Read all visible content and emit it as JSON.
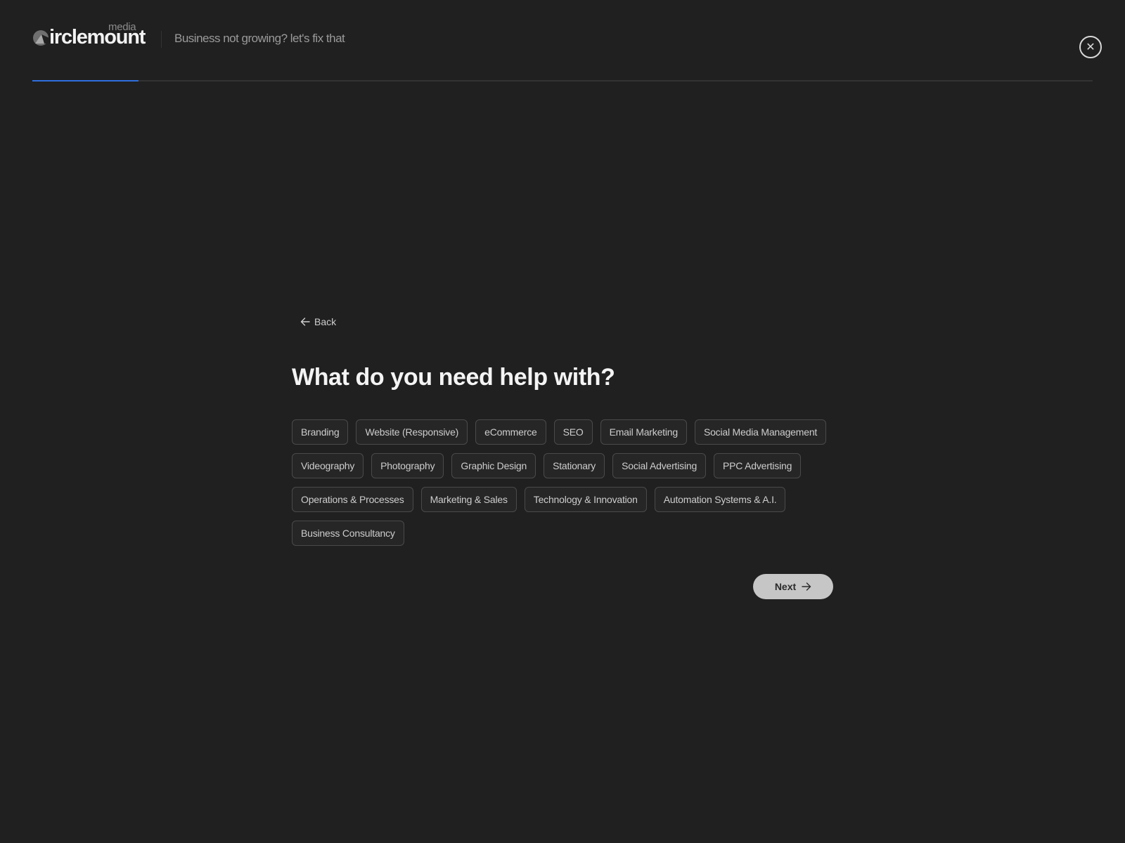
{
  "header": {
    "logo": {
      "wordmark": "irclemount",
      "sub": "media",
      "icon": "circle-mountain-logo-icon"
    },
    "tagline": "Business not growing? let's fix that",
    "close_icon": "close-icon",
    "close_glyph": "✕"
  },
  "progress": {
    "value": 0.1,
    "fill_color": "#2f6fe0",
    "track_color": "#333333"
  },
  "form": {
    "back_label": "Back",
    "back_icon": "arrow-left-icon",
    "question": "What do you need help with?",
    "options": [
      "Branding",
      "Website (Responsive)",
      "eCommerce",
      "SEO",
      "Email Marketing",
      "Social Media Management",
      "Videography",
      "Photography",
      "Graphic Design",
      "Stationary",
      "Social Advertising",
      "PPC Advertising",
      "Operations & Processes",
      "Marketing & Sales",
      "Technology & Innovation",
      "Automation Systems & A.I.",
      "Business Consultancy"
    ],
    "next_label": "Next",
    "next_icon": "arrow-right-icon"
  },
  "colors": {
    "background": "#202020",
    "chip_border": "#4a4a4a",
    "next_button_bg": "#c6c6c6"
  }
}
